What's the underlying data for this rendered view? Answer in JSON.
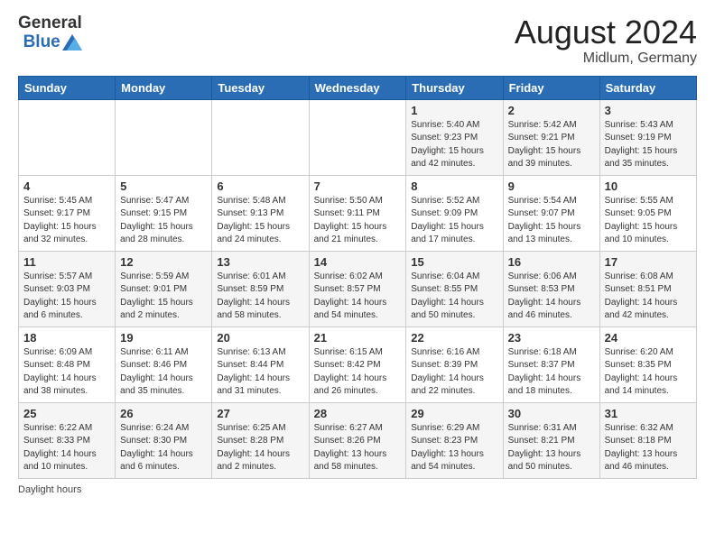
{
  "header": {
    "logo_general": "General",
    "logo_blue": "Blue",
    "month_title": "August 2024",
    "location": "Midlum, Germany"
  },
  "weekdays": [
    "Sunday",
    "Monday",
    "Tuesday",
    "Wednesday",
    "Thursday",
    "Friday",
    "Saturday"
  ],
  "weeks": [
    [
      {
        "day": "",
        "info": ""
      },
      {
        "day": "",
        "info": ""
      },
      {
        "day": "",
        "info": ""
      },
      {
        "day": "",
        "info": ""
      },
      {
        "day": "1",
        "info": "Sunrise: 5:40 AM\nSunset: 9:23 PM\nDaylight: 15 hours\nand 42 minutes."
      },
      {
        "day": "2",
        "info": "Sunrise: 5:42 AM\nSunset: 9:21 PM\nDaylight: 15 hours\nand 39 minutes."
      },
      {
        "day": "3",
        "info": "Sunrise: 5:43 AM\nSunset: 9:19 PM\nDaylight: 15 hours\nand 35 minutes."
      }
    ],
    [
      {
        "day": "4",
        "info": "Sunrise: 5:45 AM\nSunset: 9:17 PM\nDaylight: 15 hours\nand 32 minutes."
      },
      {
        "day": "5",
        "info": "Sunrise: 5:47 AM\nSunset: 9:15 PM\nDaylight: 15 hours\nand 28 minutes."
      },
      {
        "day": "6",
        "info": "Sunrise: 5:48 AM\nSunset: 9:13 PM\nDaylight: 15 hours\nand 24 minutes."
      },
      {
        "day": "7",
        "info": "Sunrise: 5:50 AM\nSunset: 9:11 PM\nDaylight: 15 hours\nand 21 minutes."
      },
      {
        "day": "8",
        "info": "Sunrise: 5:52 AM\nSunset: 9:09 PM\nDaylight: 15 hours\nand 17 minutes."
      },
      {
        "day": "9",
        "info": "Sunrise: 5:54 AM\nSunset: 9:07 PM\nDaylight: 15 hours\nand 13 minutes."
      },
      {
        "day": "10",
        "info": "Sunrise: 5:55 AM\nSunset: 9:05 PM\nDaylight: 15 hours\nand 10 minutes."
      }
    ],
    [
      {
        "day": "11",
        "info": "Sunrise: 5:57 AM\nSunset: 9:03 PM\nDaylight: 15 hours\nand 6 minutes."
      },
      {
        "day": "12",
        "info": "Sunrise: 5:59 AM\nSunset: 9:01 PM\nDaylight: 15 hours\nand 2 minutes."
      },
      {
        "day": "13",
        "info": "Sunrise: 6:01 AM\nSunset: 8:59 PM\nDaylight: 14 hours\nand 58 minutes."
      },
      {
        "day": "14",
        "info": "Sunrise: 6:02 AM\nSunset: 8:57 PM\nDaylight: 14 hours\nand 54 minutes."
      },
      {
        "day": "15",
        "info": "Sunrise: 6:04 AM\nSunset: 8:55 PM\nDaylight: 14 hours\nand 50 minutes."
      },
      {
        "day": "16",
        "info": "Sunrise: 6:06 AM\nSunset: 8:53 PM\nDaylight: 14 hours\nand 46 minutes."
      },
      {
        "day": "17",
        "info": "Sunrise: 6:08 AM\nSunset: 8:51 PM\nDaylight: 14 hours\nand 42 minutes."
      }
    ],
    [
      {
        "day": "18",
        "info": "Sunrise: 6:09 AM\nSunset: 8:48 PM\nDaylight: 14 hours\nand 38 minutes."
      },
      {
        "day": "19",
        "info": "Sunrise: 6:11 AM\nSunset: 8:46 PM\nDaylight: 14 hours\nand 35 minutes."
      },
      {
        "day": "20",
        "info": "Sunrise: 6:13 AM\nSunset: 8:44 PM\nDaylight: 14 hours\nand 31 minutes."
      },
      {
        "day": "21",
        "info": "Sunrise: 6:15 AM\nSunset: 8:42 PM\nDaylight: 14 hours\nand 26 minutes."
      },
      {
        "day": "22",
        "info": "Sunrise: 6:16 AM\nSunset: 8:39 PM\nDaylight: 14 hours\nand 22 minutes."
      },
      {
        "day": "23",
        "info": "Sunrise: 6:18 AM\nSunset: 8:37 PM\nDaylight: 14 hours\nand 18 minutes."
      },
      {
        "day": "24",
        "info": "Sunrise: 6:20 AM\nSunset: 8:35 PM\nDaylight: 14 hours\nand 14 minutes."
      }
    ],
    [
      {
        "day": "25",
        "info": "Sunrise: 6:22 AM\nSunset: 8:33 PM\nDaylight: 14 hours\nand 10 minutes."
      },
      {
        "day": "26",
        "info": "Sunrise: 6:24 AM\nSunset: 8:30 PM\nDaylight: 14 hours\nand 6 minutes."
      },
      {
        "day": "27",
        "info": "Sunrise: 6:25 AM\nSunset: 8:28 PM\nDaylight: 14 hours\nand 2 minutes."
      },
      {
        "day": "28",
        "info": "Sunrise: 6:27 AM\nSunset: 8:26 PM\nDaylight: 13 hours\nand 58 minutes."
      },
      {
        "day": "29",
        "info": "Sunrise: 6:29 AM\nSunset: 8:23 PM\nDaylight: 13 hours\nand 54 minutes."
      },
      {
        "day": "30",
        "info": "Sunrise: 6:31 AM\nSunset: 8:21 PM\nDaylight: 13 hours\nand 50 minutes."
      },
      {
        "day": "31",
        "info": "Sunrise: 6:32 AM\nSunset: 8:18 PM\nDaylight: 13 hours\nand 46 minutes."
      }
    ]
  ],
  "footer": {
    "daylight_label": "Daylight hours"
  }
}
